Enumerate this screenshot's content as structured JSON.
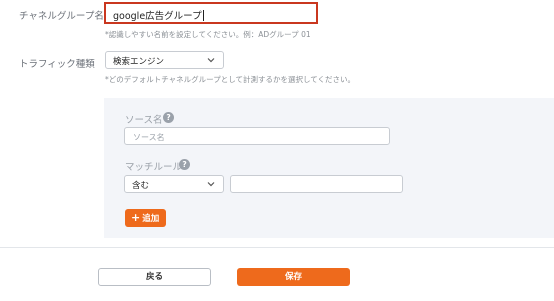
{
  "form": {
    "channel_group_label": "チャネルグループ名",
    "channel_group_value": "google広告グループ",
    "channel_group_hint": "*認識しやすい名前を設定してください。例：ADグループ 01",
    "traffic_type_label": "トラフィック種類",
    "traffic_type_value": "検索エンジン",
    "traffic_type_hint": "*どのデフォルトチャネルグループとして計測するかを選択してください。"
  },
  "rule_panel": {
    "source_label": "ソース名",
    "source_placeholder": "ソース名",
    "match_rule_label": "マッチルール",
    "match_rule_value": "含む",
    "match_value": "",
    "help_glyph": "?",
    "add_label": "追加",
    "add_icon": "plus-icon"
  },
  "actions": {
    "back_label": "戻る",
    "save_label": "保存"
  },
  "colors": {
    "accent": "#ee6a1c",
    "focus_border": "#c9371f",
    "panel_bg": "#f3f5f9"
  }
}
